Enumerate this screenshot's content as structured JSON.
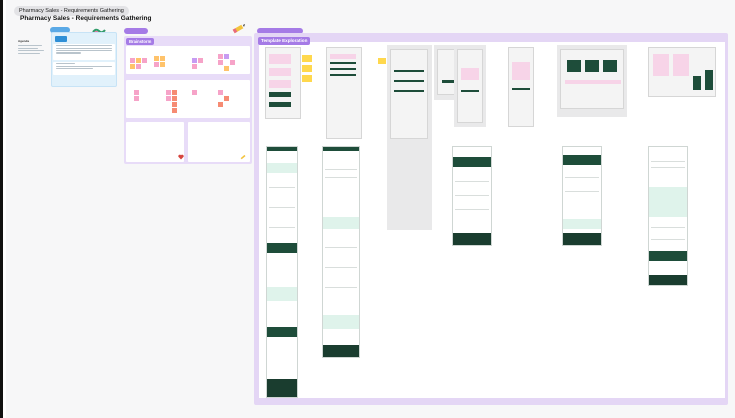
{
  "tab": {
    "label": "Pharmacy Sales - Requirements Gathering"
  },
  "board": {
    "title": "Pharmacy Sales - Requirements Gathering"
  },
  "sections": {
    "agenda_heading": "Agenda",
    "brainstorm_title": "Brainstorm",
    "template_title": "Template Exploration"
  },
  "colors": {
    "purple_section": "#e4d6f5",
    "purple_chip": "#a57be6",
    "blue_card": "#e1f1fb",
    "green_brand": "#1e4d3a",
    "pink_wire": "#f7d4e8",
    "sticky_yellow": "#ffd84d"
  },
  "icons": [
    "wave-logo-icon",
    "pencil-icon",
    "heart-icon",
    "pencil-icon-small"
  ]
}
